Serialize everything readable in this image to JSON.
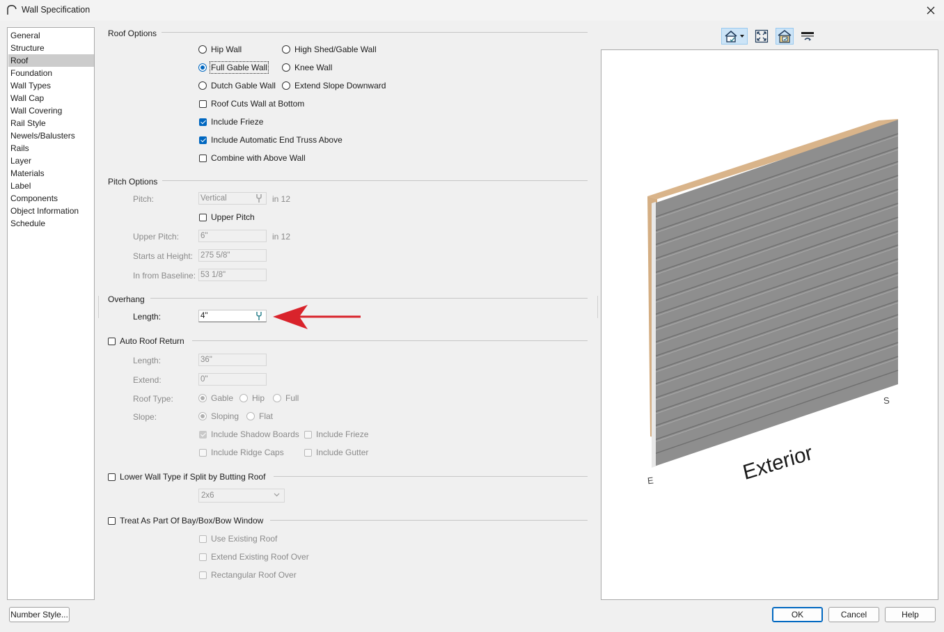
{
  "window": {
    "title": "Wall Specification"
  },
  "nav": {
    "items": [
      "General",
      "Structure",
      "Roof",
      "Foundation",
      "Wall Types",
      "Wall Cap",
      "Wall Covering",
      "Rail Style",
      "Newels/Balusters",
      "Rails",
      "Layer",
      "Materials",
      "Label",
      "Components",
      "Object Information",
      "Schedule"
    ],
    "selected": "Roof"
  },
  "roof_options": {
    "label": "Roof Options",
    "hip_wall": "Hip Wall",
    "high_shed_gable_wall": "High Shed/Gable Wall",
    "full_gable_wall": "Full Gable Wall",
    "knee_wall": "Knee Wall",
    "dutch_gable_wall": "Dutch Gable Wall",
    "extend_slope_downward": "Extend Slope Downward",
    "roof_cuts_wall_at_bottom": "Roof Cuts Wall at Bottom",
    "include_frieze": "Include Frieze",
    "include_auto_end_truss": "Include Automatic End Truss Above",
    "combine_with_above_wall": "Combine with Above Wall"
  },
  "pitch_options": {
    "label": "Pitch Options",
    "pitch_label": "Pitch:",
    "pitch_value": "Vertical",
    "in12": "in 12",
    "upper_pitch": "Upper Pitch",
    "upper_pitch_label": "Upper Pitch:",
    "upper_pitch_value": "6\"",
    "starts_at_height_label": "Starts at Height:",
    "starts_at_height_value": "275 5/8\"",
    "in_from_baseline_label": "In from Baseline:",
    "in_from_baseline_value": "53 1/8\""
  },
  "overhang": {
    "label": "Overhang",
    "length_label": "Length:",
    "length_value": "4\""
  },
  "auto_roof_return": {
    "label": "Auto Roof Return",
    "length_label": "Length:",
    "length_value": "36\"",
    "extend_label": "Extend:",
    "extend_value": "0\"",
    "roof_type_label": "Roof Type:",
    "gable": "Gable",
    "hip": "Hip",
    "full": "Full",
    "slope_label": "Slope:",
    "sloping": "Sloping",
    "flat": "Flat",
    "include_shadow_boards": "Include Shadow Boards",
    "include_frieze": "Include Frieze",
    "include_ridge_caps": "Include Ridge Caps",
    "include_gutter": "Include Gutter"
  },
  "lower_wall": {
    "label": "Lower Wall Type if Split by Butting Roof",
    "wall_type_value": "2x6"
  },
  "bay_window": {
    "label": "Treat As Part Of Bay/Box/Bow Window",
    "use_existing_roof": "Use Existing Roof",
    "extend_existing_roof_over": "Extend Existing Roof Over",
    "rectangular_roof_over": "Rectangular Roof Over"
  },
  "preview": {
    "exterior_label": "Exterior",
    "left_marker": "E",
    "right_marker": "S"
  },
  "buttons": {
    "number_style": "Number Style...",
    "ok": "OK",
    "cancel": "Cancel",
    "help": "Help"
  },
  "colors": {
    "accent": "#0067c0",
    "arrow": "#d9232b",
    "siding": "#8e8e8e",
    "wood": "#d9b48a"
  }
}
